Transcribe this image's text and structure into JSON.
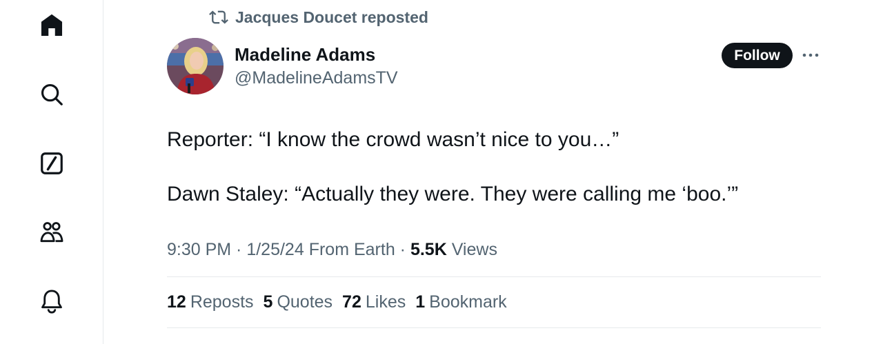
{
  "sidebar": {
    "items": [
      {
        "icon": "home-icon"
      },
      {
        "icon": "search-icon"
      },
      {
        "icon": "compose-icon"
      },
      {
        "icon": "communities-icon"
      },
      {
        "icon": "notifications-icon"
      }
    ]
  },
  "repost": {
    "icon": "repost-icon",
    "text": "Jacques Doucet reposted"
  },
  "author": {
    "display_name": "Madeline Adams",
    "handle": "@MadelineAdamsTV"
  },
  "follow_label": "Follow",
  "tweet": {
    "line1": "Reporter: “I know the crowd wasn’t nice to you…”",
    "line2": "Dawn Staley: “Actually they were. They were calling me ‘boo.’”"
  },
  "meta": {
    "time": "9:30 PM",
    "sep1": " · ",
    "date": "1/25/24",
    "location": " From Earth",
    "sep2": " · ",
    "views_count": "5.5K",
    "views_label": " Views"
  },
  "stats": [
    {
      "count": "12",
      "label": "Reposts"
    },
    {
      "count": "5",
      "label": "Quotes"
    },
    {
      "count": "72",
      "label": "Likes"
    },
    {
      "count": "1",
      "label": "Bookmark"
    }
  ],
  "colors": {
    "text_primary": "#0f1419",
    "text_secondary": "#536471",
    "divider": "#e6e9ec",
    "follow_bg": "#0f1419"
  }
}
